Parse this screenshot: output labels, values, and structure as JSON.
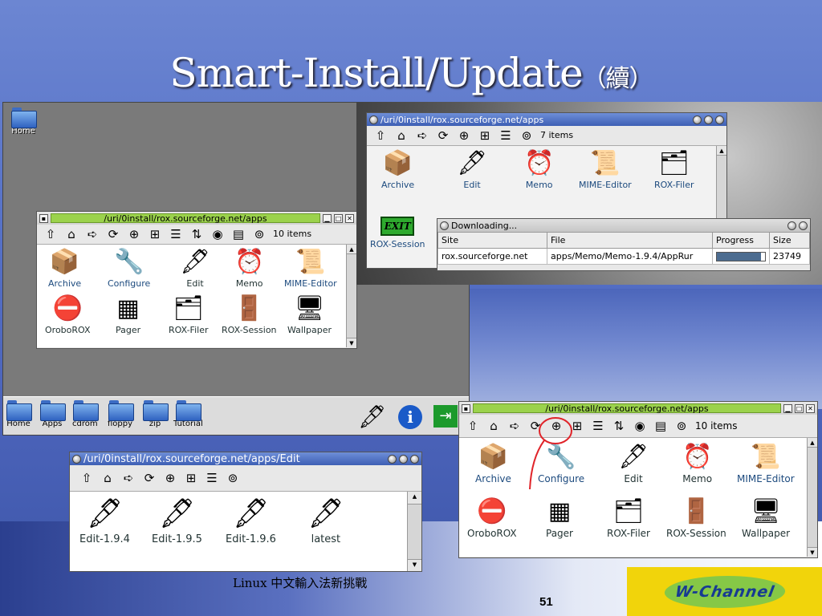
{
  "slide": {
    "title": "Smart-Install/Update",
    "title_suffix": "（續）",
    "footer": "Linux 中文輸入法新挑戰",
    "page_number": "51",
    "logo_text": "W-Channel"
  },
  "desktop": {
    "home_label": "Home",
    "panel_items": [
      "Home",
      "Apps",
      "cdrom",
      "floppy",
      "zip",
      "Tutorial"
    ]
  },
  "win_left": {
    "title": "/uri/0install/rox.sourceforge.net/apps",
    "count": "10 items",
    "items": [
      "Archive",
      "Configure",
      "Edit",
      "Memo",
      "MIME-Editor",
      "OroboROX",
      "Pager",
      "ROX-Filer",
      "ROX-Session",
      "Wallpaper"
    ]
  },
  "win_top": {
    "title": "/uri/0install/rox.sourceforge.net/apps",
    "count": "7 items",
    "items": [
      "Archive",
      "Edit",
      "Memo",
      "MIME-Editor",
      "ROX-Filer",
      "ROX-Session"
    ],
    "exit_label": "EXIT"
  },
  "download": {
    "title": "Downloading...",
    "headers": [
      "Site",
      "File",
      "Progress",
      "Size"
    ],
    "row": {
      "site": "rox.sourceforge.net",
      "file": "apps/Memo/Memo-1.9.4/AppRur",
      "size": "23749"
    },
    "progress": 0.92
  },
  "win_edit": {
    "title": "/uri/0install/rox.sourceforge.net/apps/Edit",
    "items": [
      "Edit-1.9.4",
      "Edit-1.9.5",
      "Edit-1.9.6",
      "latest"
    ]
  },
  "win_right": {
    "title": "/uri/0install/rox.sourceforge.net/apps",
    "count": "10 items",
    "items": [
      "Archive",
      "Configure",
      "Edit",
      "Memo",
      "MIME-Editor",
      "OroboROX",
      "Pager",
      "ROX-Filer",
      "ROX-Session",
      "Wallpaper"
    ]
  },
  "colors": {
    "accent": "#4a62b8",
    "title_green": "#9bd24c",
    "annotation": "#e0242a"
  }
}
